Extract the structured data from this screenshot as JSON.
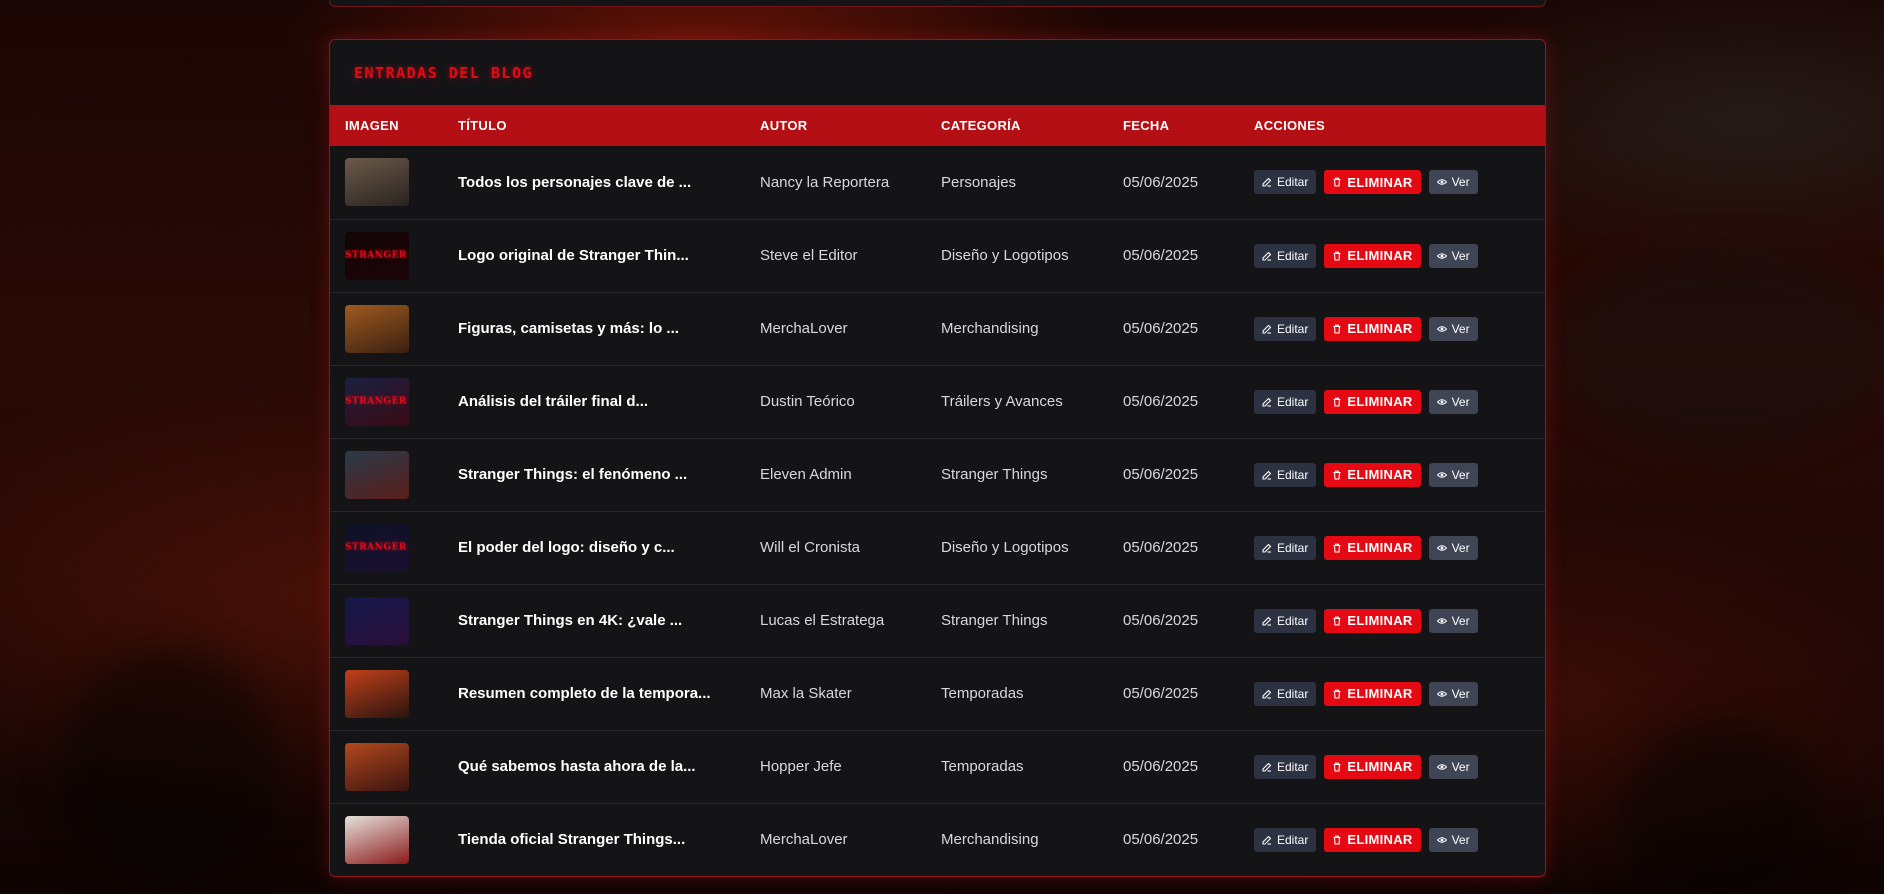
{
  "section": {
    "title": "ENTRADAS DEL BLOG"
  },
  "table": {
    "headers": {
      "image": "IMAGEN",
      "title": "TÍTULO",
      "author": "AUTOR",
      "category": "CATEGORÍA",
      "date": "FECHA",
      "actions": "ACCIONES"
    },
    "actions": {
      "edit_label": "Editar",
      "delete_label": "ELIMINAR",
      "view_label": "Ver"
    },
    "rows": [
      {
        "title": "Todos los personajes clave de ...",
        "author": "Nancy la Reportera",
        "category": "Personajes",
        "date": "05/06/2025",
        "thumb": {
          "c1": "#6b5a4a",
          "c2": "#2a2320",
          "text": ""
        }
      },
      {
        "title": "Logo original de Stranger Thin...",
        "author": "Steve el Editor",
        "category": "Diseño y Logotipos",
        "date": "05/06/2025",
        "thumb": {
          "c1": "#120406",
          "c2": "#1c0508",
          "text": "STRANGER THINGS"
        }
      },
      {
        "title": "Figuras, camisetas y más: lo ...",
        "author": "MerchaLover",
        "category": "Merchandising",
        "date": "05/06/2025",
        "thumb": {
          "c1": "#a05a1e",
          "c2": "#3a2012",
          "text": ""
        }
      },
      {
        "title": "Análisis del tráiler final d...",
        "author": "Dustin Teórico",
        "category": "Tráilers y Avances",
        "date": "05/06/2025",
        "thumb": {
          "c1": "#1a2040",
          "c2": "#3a0a14",
          "text": "STRANGER THINGS"
        }
      },
      {
        "title": "Stranger Things: el fenómeno ...",
        "author": "Eleven Admin",
        "category": "Stranger Things",
        "date": "05/06/2025",
        "thumb": {
          "c1": "#2a3a4a",
          "c2": "#5a1e1a",
          "text": ""
        }
      },
      {
        "title": "El poder del logo: diseño y c...",
        "author": "Will el Cronista",
        "category": "Diseño y Logotipos",
        "date": "05/06/2025",
        "thumb": {
          "c1": "#0e1226",
          "c2": "#1a1030",
          "text": "STRANGER THINGS"
        }
      },
      {
        "title": "Stranger Things en 4K: ¿vale ...",
        "author": "Lucas el Estratega",
        "category": "Stranger Things",
        "date": "05/06/2025",
        "thumb": {
          "c1": "#14184a",
          "c2": "#2a0e3a",
          "text": ""
        }
      },
      {
        "title": "Resumen completo de la tempora...",
        "author": "Max la Skater",
        "category": "Temporadas",
        "date": "05/06/2025",
        "thumb": {
          "c1": "#c2401a",
          "c2": "#2a1410",
          "text": ""
        }
      },
      {
        "title": "Qué sabemos hasta ahora de la...",
        "author": "Hopper Jefe",
        "category": "Temporadas",
        "date": "05/06/2025",
        "thumb": {
          "c1": "#b4481e",
          "c2": "#3a1410",
          "text": ""
        }
      },
      {
        "title": "Tienda oficial Stranger Things...",
        "author": "MerchaLover",
        "category": "Merchandising",
        "date": "05/06/2025",
        "thumb": {
          "c1": "#e6e2dc",
          "c2": "#8a1a1a",
          "text": ""
        }
      }
    ]
  },
  "colors": {
    "accent": "#e50914",
    "header_bar": "#b30f14",
    "card_bg": "#141417",
    "edit_btn": "#2c3242",
    "view_btn": "#3f4555"
  }
}
